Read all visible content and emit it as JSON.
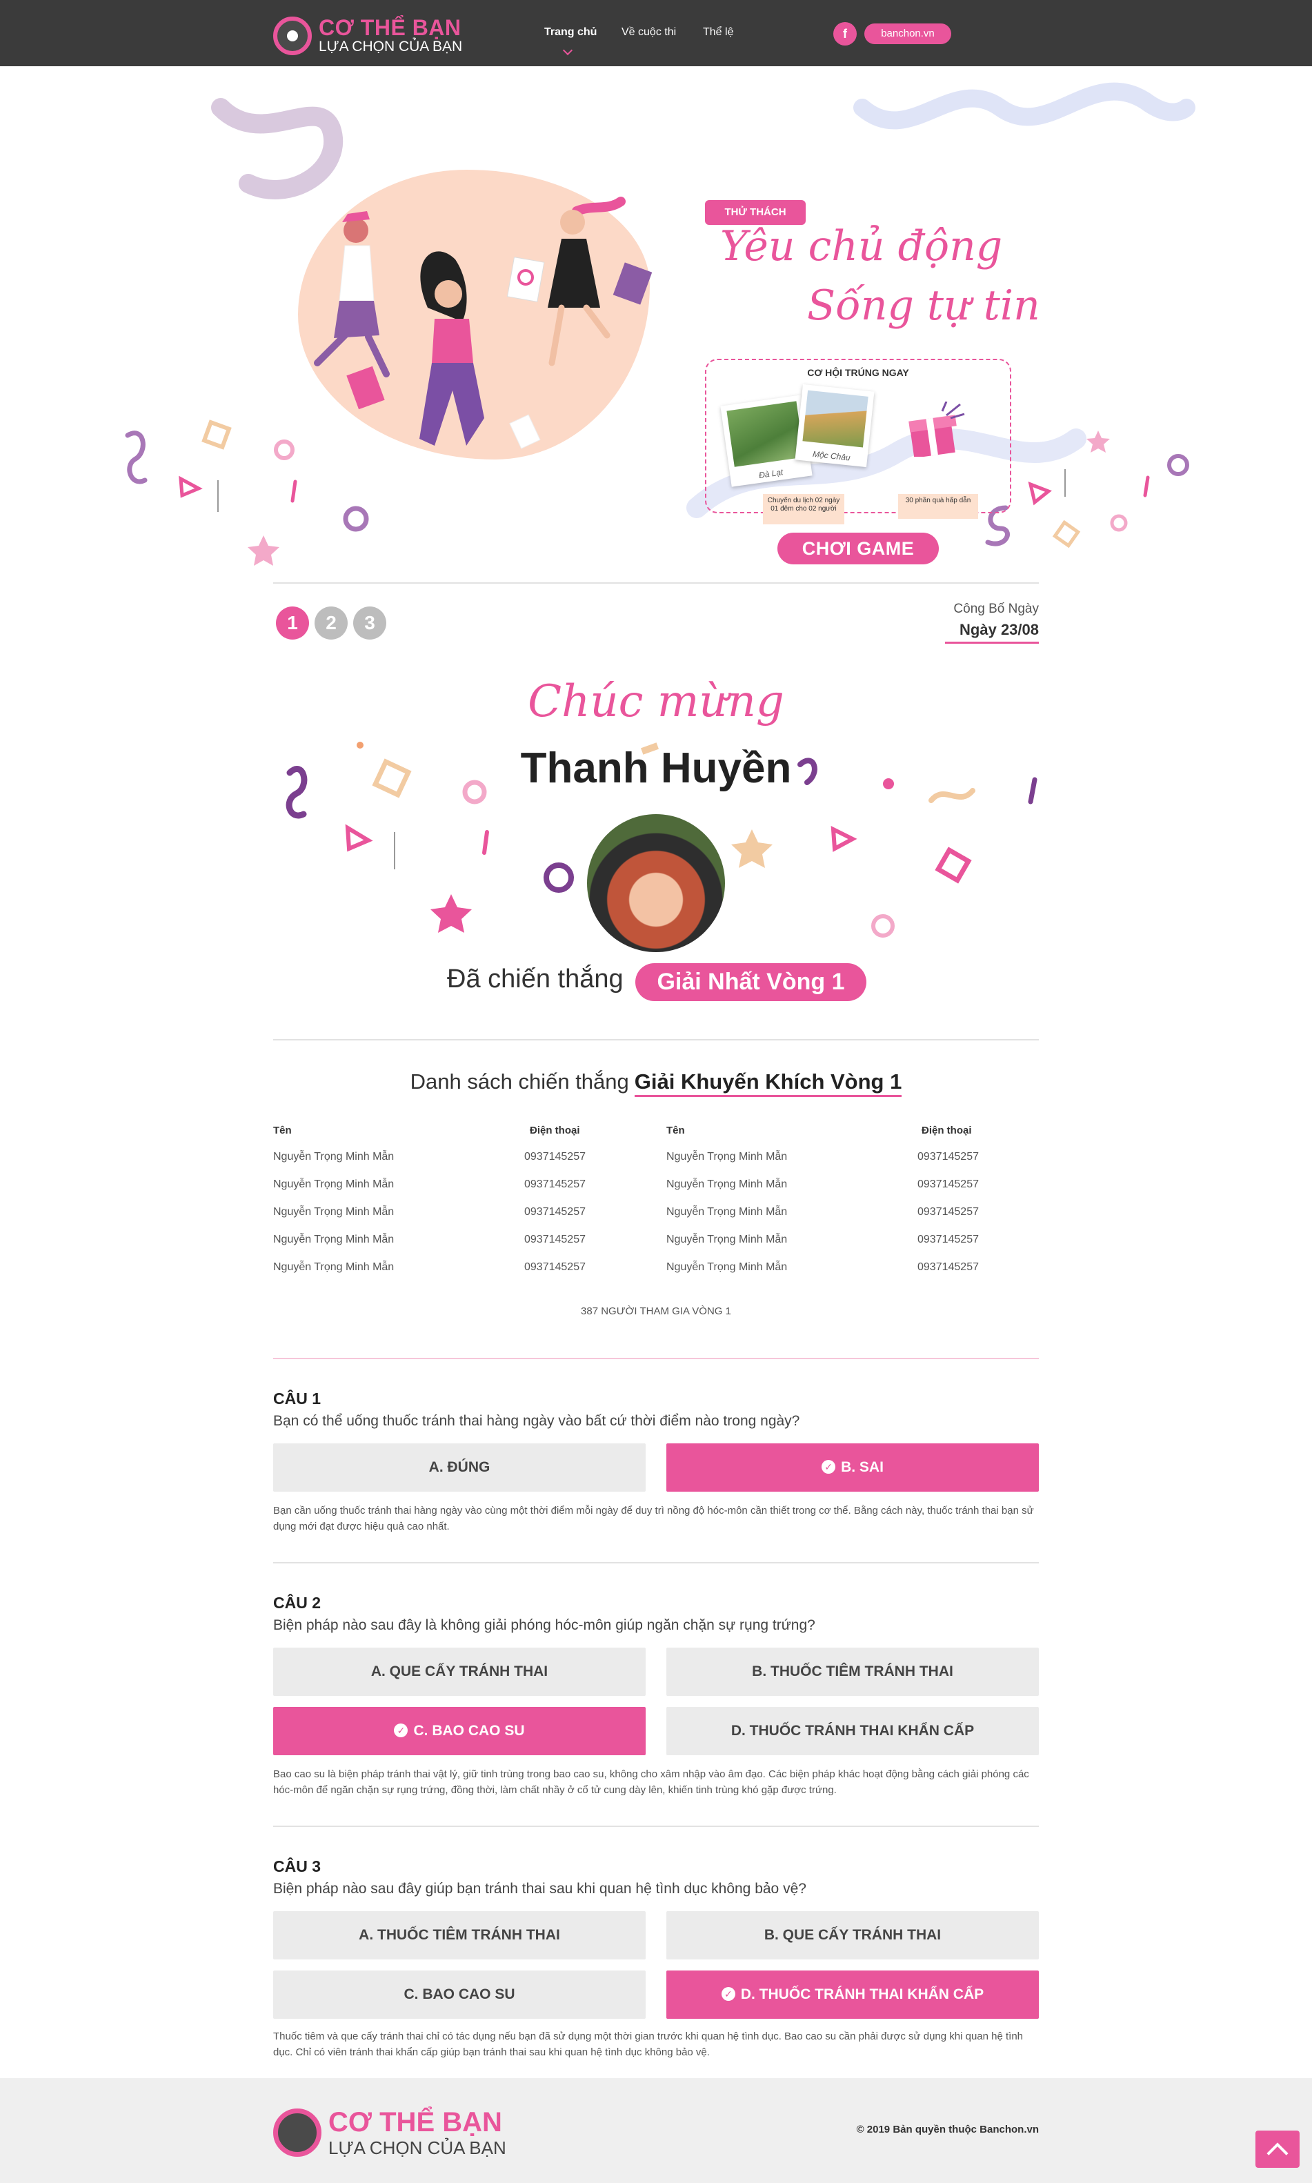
{
  "header": {
    "logo_line1": "CƠ THỂ BẠN",
    "logo_line2": "LỰA CHỌN CỦA BẠN",
    "nav": [
      "Trang chủ",
      "Về cuộc thi",
      "Thể lệ"
    ],
    "facebook_glyph": "f",
    "site_label": "banchon.vn"
  },
  "hero": {
    "tag": "THỬ THÁCH",
    "title_line1": "Yêu chủ động",
    "title_line2": "Sống tự tin",
    "prize_title": "CƠ HỘI TRÚNG NGAY",
    "photo1_caption": "Đà Lạt",
    "photo2_caption": "Mộc Châu",
    "note1": "Chuyến du lịch 02 ngày 01 đêm cho 02 người",
    "note2": "30 phần quà hấp dẫn",
    "play_button": "CHƠI GAME"
  },
  "rounds": {
    "steps": [
      "1",
      "2",
      "3"
    ],
    "active_step": "1",
    "announce_label": "Công Bố Ngày",
    "announce_date": "Ngày 23/08"
  },
  "winner": {
    "congrats": "Chúc mừng",
    "name": "Thanh Huyền",
    "won_label": "Đã chiến thắng",
    "prize": "Giải Nhất Vòng 1"
  },
  "winners_list": {
    "title_prefix": "Danh sách chiến thắng",
    "title_prize": "Giải Khuyến Khích Vòng 1",
    "col_name": "Tên",
    "col_phone": "Điện thoại",
    "rows_left": [
      {
        "name": "Nguyễn Trọng Minh Mẫn",
        "phone": "0937145257"
      },
      {
        "name": "Nguyễn Trọng Minh Mẫn",
        "phone": "0937145257"
      },
      {
        "name": "Nguyễn Trọng Minh Mẫn",
        "phone": "0937145257"
      },
      {
        "name": "Nguyễn Trọng Minh Mẫn",
        "phone": "0937145257"
      },
      {
        "name": "Nguyễn Trọng Minh Mẫn",
        "phone": "0937145257"
      }
    ],
    "rows_right": [
      {
        "name": "Nguyễn Trọng Minh Mẫn",
        "phone": "0937145257"
      },
      {
        "name": "Nguyễn Trọng Minh Mẫn",
        "phone": "0937145257"
      },
      {
        "name": "Nguyễn Trọng Minh Mẫn",
        "phone": "0937145257"
      },
      {
        "name": "Nguyễn Trọng Minh Mẫn",
        "phone": "0937145257"
      },
      {
        "name": "Nguyễn Trọng Minh Mẫn",
        "phone": "0937145257"
      }
    ],
    "participants": "387 NGƯỜI THAM GIA VÒNG 1"
  },
  "questions": [
    {
      "label": "CÂU 1",
      "text": "Bạn có thể uống thuốc tránh thai hàng ngày vào bất cứ thời điểm nào trong ngày?",
      "answers": [
        "A. ĐÚNG",
        "B. SAI"
      ],
      "correct": "B. SAI",
      "explanation": "Bạn cần uống thuốc tránh thai hàng ngày vào cùng một thời điểm mỗi ngày để duy trì nồng độ hóc-môn cần thiết trong cơ thể. Bằng cách này, thuốc tránh thai bạn sử dụng mới đạt được hiệu quả cao nhất."
    },
    {
      "label": "CÂU 2",
      "text": "Biện pháp nào sau đây là không giải phóng hóc-môn giúp ngăn chặn sự rụng trứng?",
      "answers": [
        "A. QUE CẤY TRÁNH THAI",
        "B. THUỐC TIÊM TRÁNH THAI",
        "C. BAO CAO SU",
        "D. THUỐC TRÁNH THAI KHẨN CẤP"
      ],
      "correct": "C. BAO CAO SU",
      "explanation": "Bao cao su là biện pháp tránh thai vật lý, giữ tinh trùng trong bao cao su, không cho xâm nhập vào âm đạo. Các biện pháp khác hoạt động bằng cách giải phóng các hóc-môn để ngăn chặn sự rụng trứng, đồng thời, làm chất nhầy ở cổ tử cung dày lên, khiến tinh trùng khó gặp được trứng."
    },
    {
      "label": "CÂU 3",
      "text": "Biện pháp nào sau đây giúp bạn tránh thai sau khi quan hệ tình dục không bảo vệ?",
      "answers": [
        "A. THUỐC TIÊM TRÁNH THAI",
        "B. QUE CẤY TRÁNH THAI",
        "C. BAO CAO SU",
        "D. THUỐC TRÁNH THAI KHẨN CẤP"
      ],
      "correct": "D. THUỐC TRÁNH THAI KHẨN CẤP",
      "explanation": "Thuốc tiêm và que cấy tránh thai chỉ có tác dụng nếu bạn đã sử dụng một thời gian trước khi quan hệ tình dục. Bao cao su cần phải được sử dụng khi quan hệ tình dục. Chỉ có viên tránh thai khẩn cấp giúp bạn tránh thai sau khi quan hệ tình dục không bảo vệ."
    }
  ],
  "footer": {
    "logo_line1": "CƠ THỂ BẠN",
    "logo_line2": "LỰA CHỌN CỦA BẠN",
    "copyright": "© 2019 Bản quyền thuộc Banchon.vn"
  },
  "colors": {
    "accent": "#e9559b",
    "header_bg": "#3b3b3b",
    "answer_bg": "#ebebeb",
    "footer_bg": "#efefef",
    "hero_blob": "#fcd9c7"
  },
  "icons": [
    "facebook-icon",
    "check-circle-icon",
    "arrow-up-icon"
  ]
}
